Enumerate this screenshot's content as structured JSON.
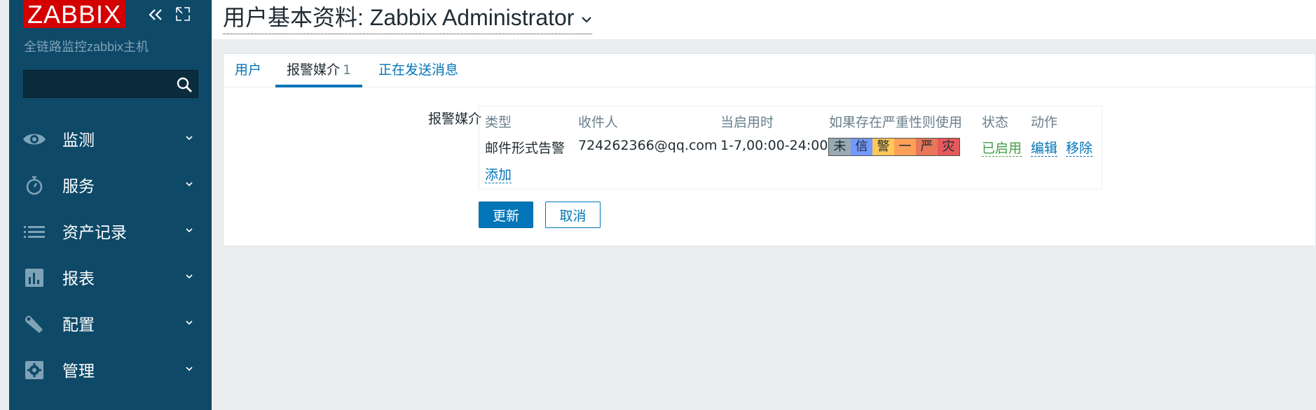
{
  "app": {
    "logo": "ZABBIX",
    "server_name": "全链路监控zabbix主机"
  },
  "search": {
    "value": "",
    "placeholder": ""
  },
  "sidebar": {
    "items": [
      {
        "label": "监测",
        "icon": "eye-icon"
      },
      {
        "label": "服务",
        "icon": "stopwatch-icon"
      },
      {
        "label": "资产记录",
        "icon": "list-icon"
      },
      {
        "label": "报表",
        "icon": "bar-chart-icon"
      },
      {
        "label": "配置",
        "icon": "wrench-icon"
      },
      {
        "label": "管理",
        "icon": "gear-icon"
      }
    ]
  },
  "header": {
    "title": "用户基本资料: Zabbix Administrator"
  },
  "tabs": [
    {
      "label": "用户"
    },
    {
      "label": "报警媒介",
      "count": "1"
    },
    {
      "label": "正在发送消息"
    }
  ],
  "form": {
    "media_label": "报警媒介",
    "columns": [
      "类型",
      "收件人",
      "当启用时",
      "如果存在严重性则使用",
      "状态",
      "动作"
    ],
    "rows": [
      {
        "type": "邮件形式告警",
        "recipient": "724262366@qq.com",
        "when_active": "1-7,00:00-24:00",
        "severities": [
          {
            "label": "未",
            "color": "#97aab3"
          },
          {
            "label": "信",
            "color": "#7499ff"
          },
          {
            "label": "警",
            "color": "#ffc859"
          },
          {
            "label": "一",
            "color": "#ffa059"
          },
          {
            "label": "严",
            "color": "#e97659"
          },
          {
            "label": "灾",
            "color": "#e45959"
          }
        ],
        "status": "已启用",
        "edit": "编辑",
        "remove": "移除"
      }
    ],
    "add_label": "添加",
    "update_button": "更新",
    "cancel_button": "取消"
  },
  "colors": {
    "sidebar_bg": "#0e4968",
    "accent": "#0275b8",
    "logo_bg": "#d40000",
    "status_green": "#429e47"
  }
}
